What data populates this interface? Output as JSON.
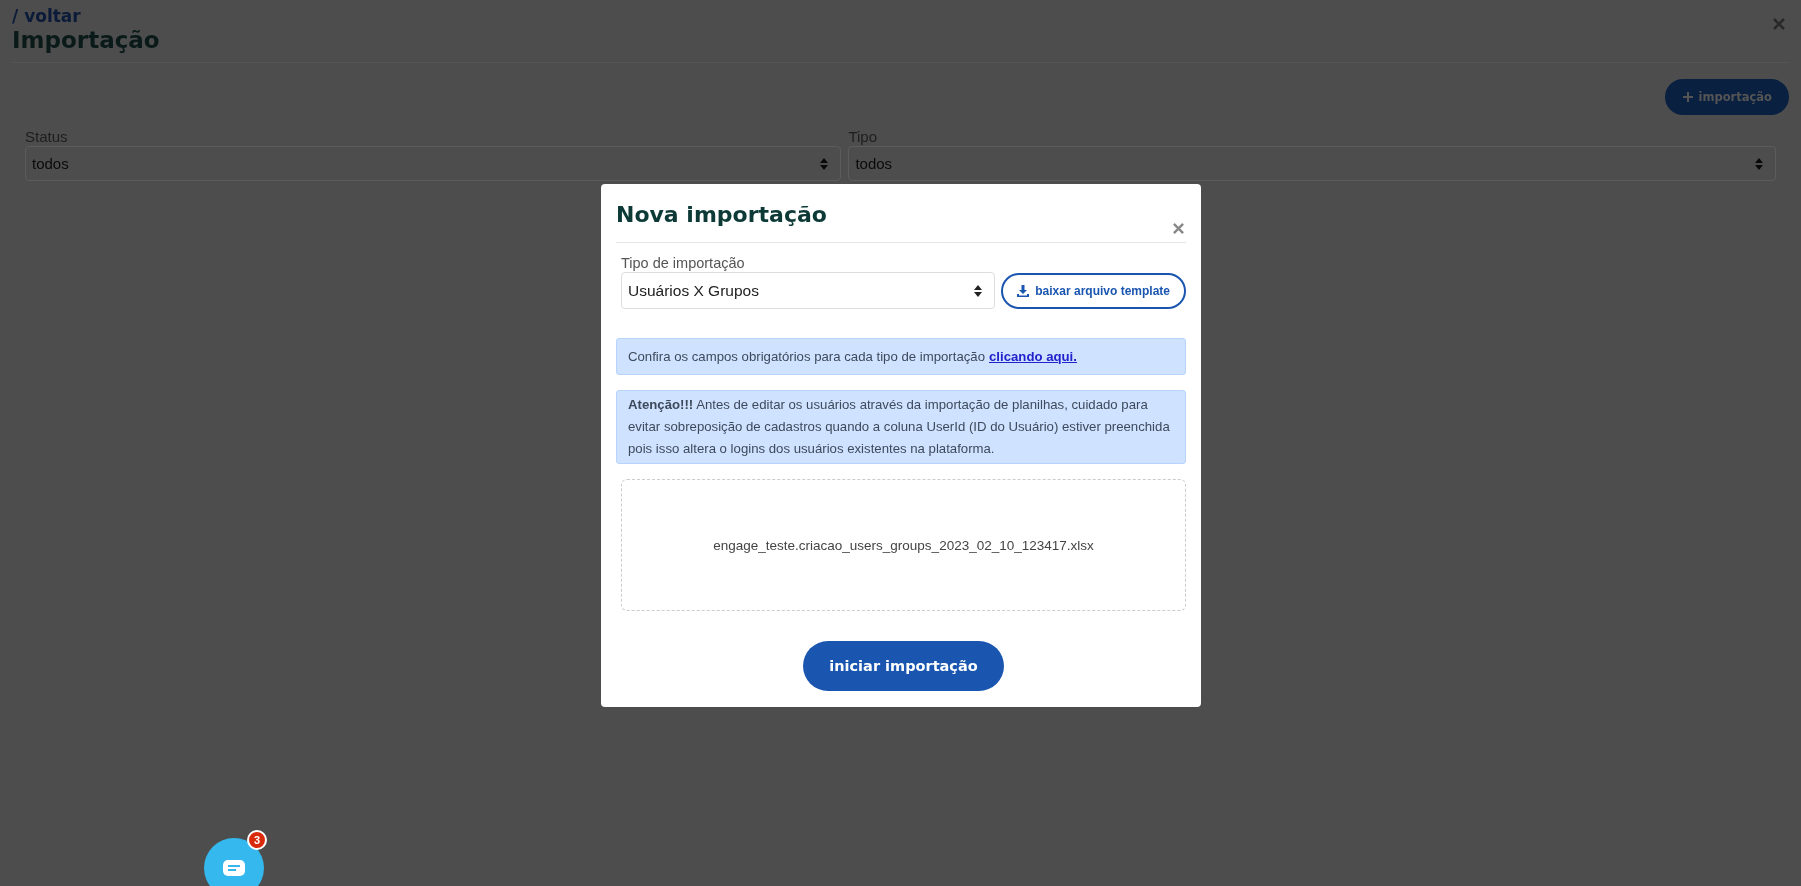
{
  "page": {
    "back_link": "/ voltar",
    "title": "Importação"
  },
  "new_button": {
    "label": "importação"
  },
  "filters": [
    {
      "label": "Status",
      "value": "todos"
    },
    {
      "label": "Tipo",
      "value": "todos"
    }
  ],
  "modal": {
    "title": "Nova importação",
    "field": {
      "label": "Tipo de importação",
      "value": "Usuários X Grupos"
    },
    "template_button": "baixar arquivo template",
    "info": {
      "text": "Confira os campos obrigatórios para cada tipo de importação",
      "link": "clicando aqui."
    },
    "warning": "**Atenção!!!** Antes de editar os usuários através da importação de planilhas, cuidado para evitar sobreposição de cadastros quando a coluna UserId (ID do Usuário) estiver preenchida pois isso altera o logins dos usuários existentes na plataforma.",
    "file_name": "engage_teste.criacao_users_groups_2023_02_10_123417.xlsx",
    "submit": "iniciar importação"
  },
  "chat": {
    "badge": "3"
  }
}
